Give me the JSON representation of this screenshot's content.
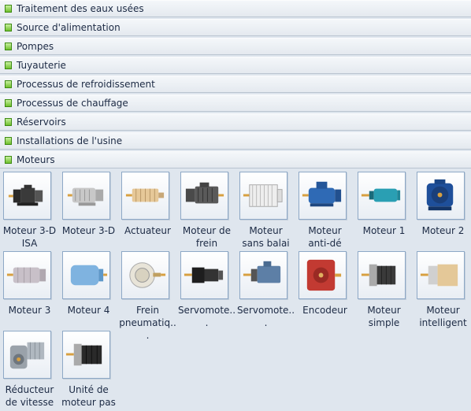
{
  "categories": [
    {
      "label": "Traitement des eaux usées"
    },
    {
      "label": "Source d'alimentation"
    },
    {
      "label": "Pompes"
    },
    {
      "label": "Tuyauterie"
    },
    {
      "label": "Processus de refroidissement"
    },
    {
      "label": "Processus de chauffage"
    },
    {
      "label": "Réservoirs"
    },
    {
      "label": "Installations de l'usine"
    },
    {
      "label": "Moteurs"
    }
  ],
  "motors": [
    {
      "l1": "Moteur 3-D",
      "l2": "ISA",
      "icon": "motor-3d-isa-icon"
    },
    {
      "l1": "Moteur 3-D",
      "l2": "",
      "icon": "motor-3d-icon"
    },
    {
      "l1": "Actuateur",
      "l2": "",
      "icon": "actuator-icon"
    },
    {
      "l1": "Moteur de",
      "l2": "frein",
      "icon": "brake-motor-icon"
    },
    {
      "l1": "Moteur",
      "l2": "sans balai",
      "icon": "brushless-motor-icon"
    },
    {
      "l1": "Moteur",
      "l2": "anti-dé",
      "icon": "explosion-proof-motor-icon"
    },
    {
      "l1": "Moteur 1",
      "l2": "",
      "icon": "motor-1-icon"
    },
    {
      "l1": "Moteur 2",
      "l2": "",
      "icon": "motor-2-icon"
    },
    {
      "l1": "Moteur 3",
      "l2": "",
      "icon": "motor-3-icon"
    },
    {
      "l1": "Moteur 4",
      "l2": "",
      "icon": "motor-4-icon"
    },
    {
      "l1": "Frein",
      "l2": "pneumatiq...",
      "icon": "pneumatic-brake-icon"
    },
    {
      "l1": "Servomote...",
      "l2": "",
      "icon": "servo-motor-icon"
    },
    {
      "l1": "Servomote...",
      "l2": "",
      "icon": "servo-motor-2-icon"
    },
    {
      "l1": "Encodeur",
      "l2": "",
      "icon": "encoder-icon"
    },
    {
      "l1": "Moteur",
      "l2": "simple",
      "icon": "simple-motor-icon"
    },
    {
      "l1": "Moteur",
      "l2": "intelligent",
      "icon": "smart-motor-icon"
    },
    {
      "l1": "Réducteur",
      "l2": "de vitesse",
      "icon": "speed-reducer-icon"
    },
    {
      "l1": "Unité de",
      "l2": "moteur pas",
      "icon": "stepper-motor-icon"
    }
  ]
}
